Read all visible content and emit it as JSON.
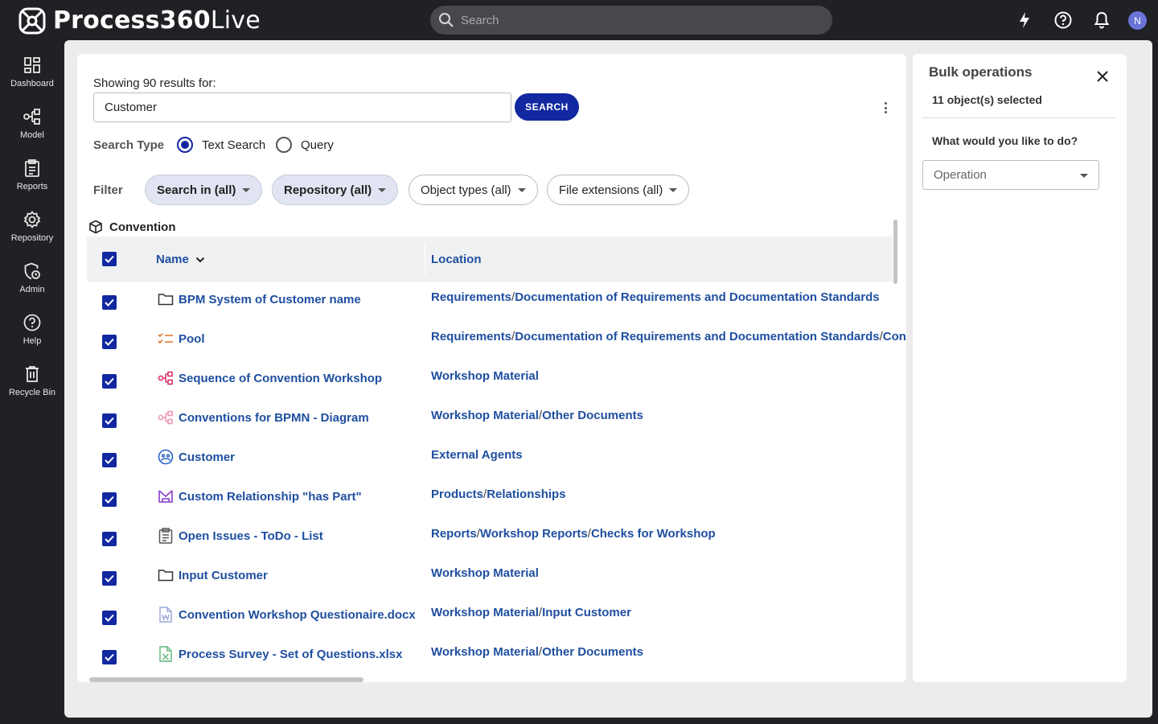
{
  "app": {
    "logo_bold": "Process360",
    "logo_light": "Live",
    "search_placeholder": "Search",
    "avatar_initial": "N"
  },
  "sidebar": {
    "items": [
      {
        "label": "Dashboard",
        "icon": "dashboard-icon"
      },
      {
        "label": "Model",
        "icon": "model-icon"
      },
      {
        "label": "Reports",
        "icon": "reports-icon"
      },
      {
        "label": "Repository",
        "icon": "repository-icon"
      },
      {
        "label": "Admin",
        "icon": "admin-icon"
      },
      {
        "label": "Help",
        "icon": "help-icon"
      },
      {
        "label": "Recycle Bin",
        "icon": "recycle-bin-icon"
      }
    ]
  },
  "results": {
    "showing_text": "Showing 90 results for:",
    "query": "Customer",
    "search_button": "SEARCH",
    "search_type_label": "Search Type",
    "radio_text": "Text Search",
    "radio_query": "Query",
    "filter_label": "Filter",
    "filters": [
      "Search in (all)",
      "Repository (all)",
      "Object types (all)",
      "File extensions (all)"
    ],
    "group_title": "Convention",
    "columns": {
      "name": "Name",
      "location": "Location"
    },
    "rows": [
      {
        "name": "BPM System of Customer name",
        "icon": "folder-icon",
        "location": [
          "Requirements",
          "Documentation of Requirements and Documentation Standards"
        ]
      },
      {
        "name": "Pool",
        "icon": "pool-icon",
        "location": [
          "Requirements",
          "Documentation of Requirements and Documentation Standards",
          "Conv"
        ]
      },
      {
        "name": "Sequence of Convention Workshop",
        "icon": "diagram-icon",
        "location": [
          "Workshop Material"
        ]
      },
      {
        "name": "Conventions for BPMN - Diagram",
        "icon": "diagram-light-icon",
        "location": [
          "Workshop Material",
          "Other Documents"
        ]
      },
      {
        "name": "Customer",
        "icon": "agent-icon",
        "location": [
          "External Agents"
        ]
      },
      {
        "name": "Custom Relationship \"has Part\"",
        "icon": "relationship-icon",
        "location": [
          "Products",
          "Relationships"
        ]
      },
      {
        "name": "Open Issues - ToDo - List",
        "icon": "report-icon",
        "location": [
          "Reports",
          "Workshop Reports",
          "Checks for Workshop"
        ]
      },
      {
        "name": "Input Customer",
        "icon": "folder-icon",
        "location": [
          "Workshop Material"
        ]
      },
      {
        "name": "Convention Workshop Questionaire.docx",
        "icon": "word-file-icon",
        "location": [
          "Workshop Material",
          "Input Customer"
        ]
      },
      {
        "name": "Process Survey - Set of Questions.xlsx",
        "icon": "excel-file-icon",
        "location": [
          "Workshop Material",
          "Other Documents"
        ]
      }
    ]
  },
  "bulk": {
    "title": "Bulk operations",
    "count": "11 object(s) selected",
    "question": "What would you like to do?",
    "operation_placeholder": "Operation"
  },
  "colors": {
    "accent": "#1128a0",
    "link": "#1f4fa0",
    "topbar": "#1f2124"
  }
}
